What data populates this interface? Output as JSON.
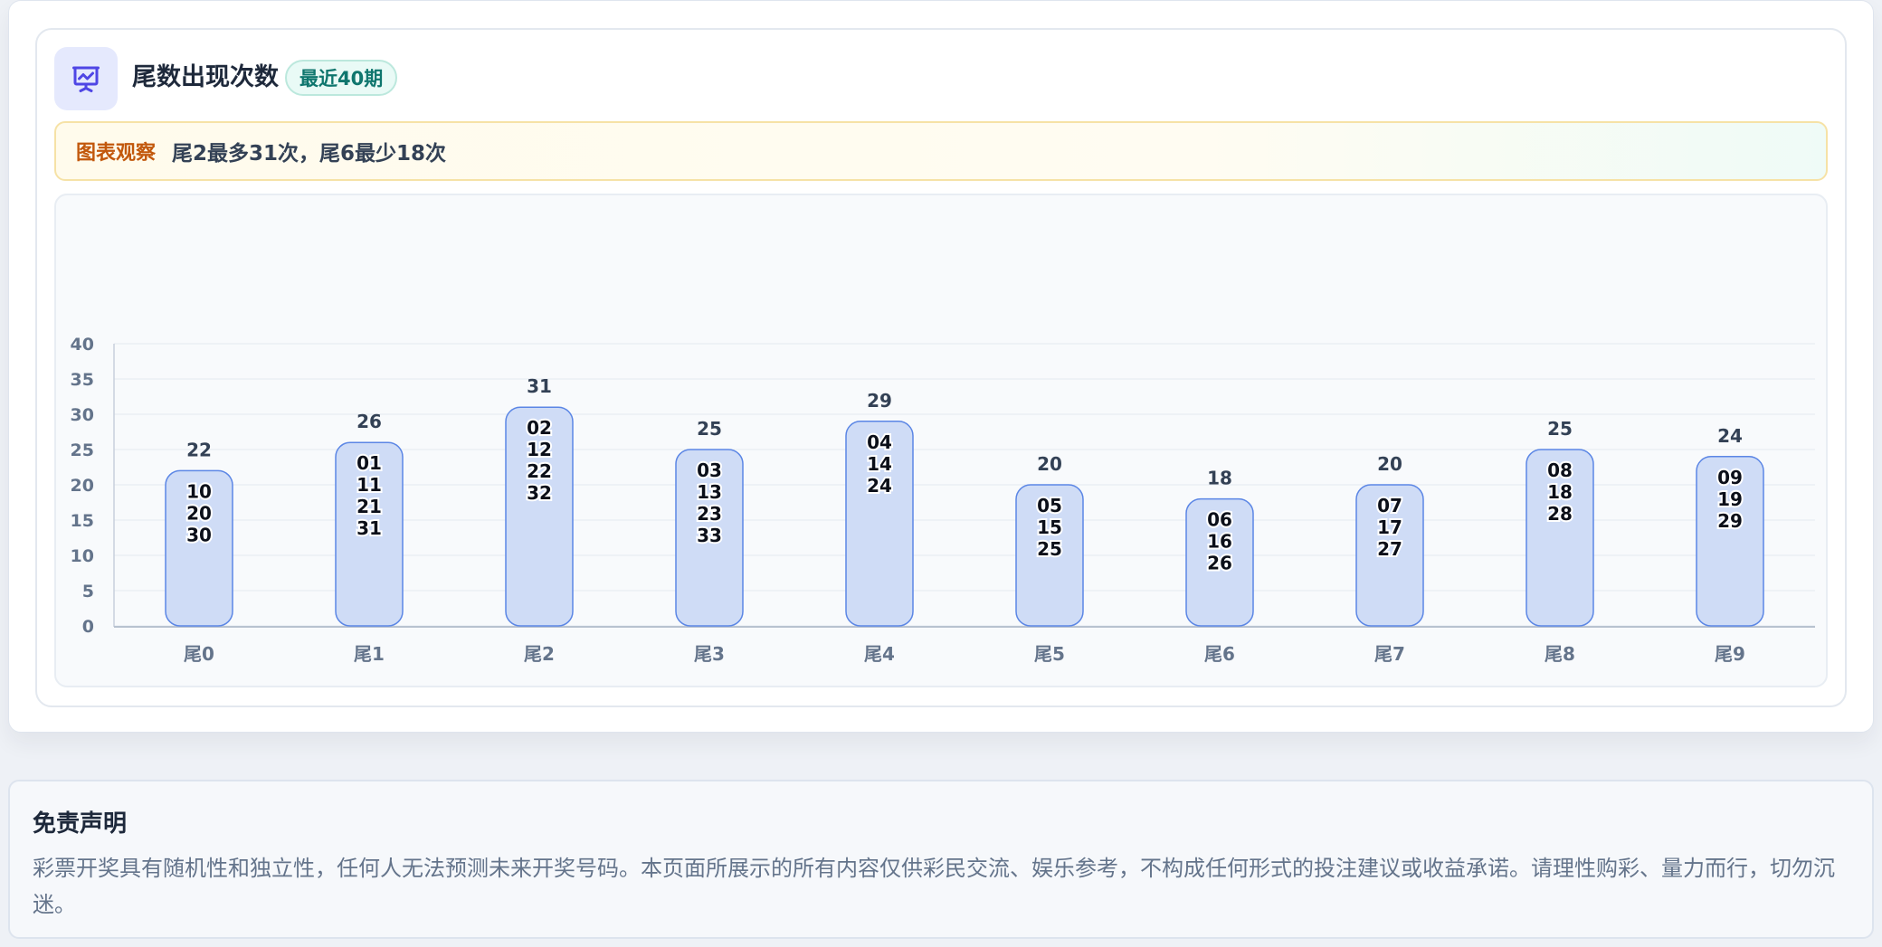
{
  "header": {
    "title": "尾数出现次数",
    "badge": "最近40期",
    "icon": "presentation-chart-icon"
  },
  "insight": {
    "label": "图表观察",
    "text": "尾2最多31次，尾6最少18次"
  },
  "colors": {
    "bar_fill": "#cfdcf6",
    "bar_stroke": "#5b86e5",
    "axis_text": "#64748b",
    "grid": "#e5e9f0",
    "badge_text": "#0f766e",
    "insight_label": "#c2580c"
  },
  "chart_data": {
    "type": "bar",
    "categories": [
      "尾0",
      "尾1",
      "尾2",
      "尾3",
      "尾4",
      "尾5",
      "尾6",
      "尾7",
      "尾8",
      "尾9"
    ],
    "values": [
      22,
      26,
      31,
      25,
      29,
      20,
      18,
      20,
      25,
      24
    ],
    "bar_numbers": [
      [
        "10",
        "20",
        "30"
      ],
      [
        "01",
        "11",
        "21",
        "31"
      ],
      [
        "02",
        "12",
        "22",
        "32"
      ],
      [
        "03",
        "13",
        "23",
        "33"
      ],
      [
        "04",
        "14",
        "24"
      ],
      [
        "05",
        "15",
        "25"
      ],
      [
        "06",
        "16",
        "26"
      ],
      [
        "07",
        "17",
        "27"
      ],
      [
        "08",
        "18",
        "28"
      ],
      [
        "09",
        "19",
        "29"
      ]
    ],
    "ylim": [
      0,
      40
    ],
    "yticks": [
      0,
      5,
      10,
      15,
      20,
      25,
      30,
      35,
      40
    ],
    "grid": true,
    "legend": "none"
  },
  "disclaimer": {
    "title": "免责声明",
    "text": "彩票开奖具有随机性和独立性，任何人无法预测未来开奖号码。本页面所展示的所有内容仅供彩民交流、娱乐参考，不构成任何形式的投注建议或收益承诺。请理性购彩、量力而行，切勿沉迷。"
  }
}
